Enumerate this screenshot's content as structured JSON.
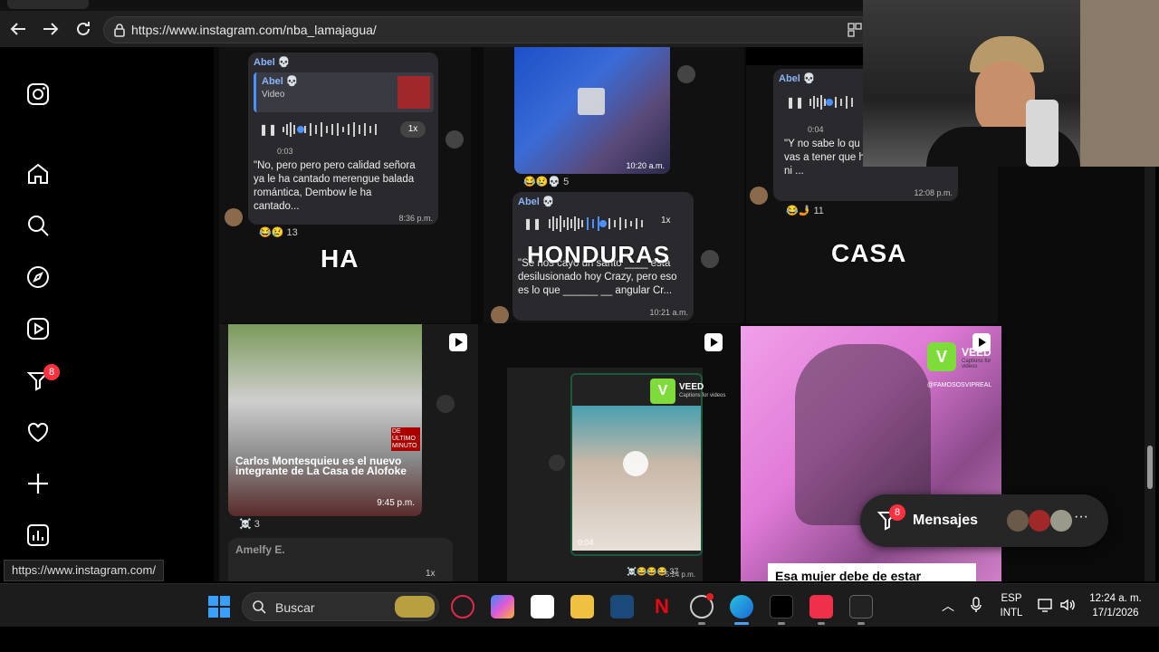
{
  "browser": {
    "url": "https://www.instagram.com/nba_lamajagua/",
    "status_url": "https://www.instagram.com/"
  },
  "instagram": {
    "nav_icons": [
      "instagram-logo-icon",
      "home-icon",
      "search-icon",
      "explore-compass-icon",
      "reels-icon",
      "notifications-icon",
      "heart-icon",
      "create-plus-icon",
      "dashboard-icon"
    ],
    "notifications_badge": "8"
  },
  "posts": {
    "tile1": {
      "sender": "Abel 💀",
      "quoted_sender": "Abel 💀",
      "quoted_type": "Video",
      "duration": "0:03",
      "speed": "1x",
      "message": "\"No, pero pero pero calidad señora ya le ha cantado merengue balada romántica, Dembow le ha cantado...",
      "time": "8:36 p.m.",
      "reactions": "😂😢 13",
      "overlay": "HA"
    },
    "tile2": {
      "image_time": "10:20 a.m.",
      "image_reactions": "😂😢💀 5",
      "sender": "Abel 💀",
      "speed": "1x",
      "message": "\"Se nos cayó un santo ____ está desilusionado hoy Crazy, pero eso es lo que ______ __ angular Cr...",
      "time": "10:21 a.m.",
      "overlay": "HONDURAS"
    },
    "tile3": {
      "sender": "Abel 💀",
      "duration": "0:04",
      "message": "\"Y no sabe lo qu metió ese loco, vas a tener que hacer esa casa, ya ni ...",
      "time": "12:08 p.m.",
      "reactions": "😂🤳 11",
      "overlay": "CASA"
    },
    "tile4": {
      "badge": "DE ÚLTIMO MINUTO",
      "headline": "Carlos Montesquieu es el nuevo integrante de La Casa de Alofoke",
      "time": "9:45 p.m.",
      "reactions": "☠️ 3",
      "next_sender": "Amelfy E.",
      "next_speed": "1x"
    },
    "tile5": {
      "veed_brand": "VEED",
      "veed_tagline": "Captions for videos",
      "video_time": "0:04",
      "video_stamp": "5:24 p.m.",
      "reactions": "☠️😂😂😂 37"
    },
    "tile6": {
      "veed_brand": "VEED",
      "veed_tagline": "Captions for videos",
      "watermark": "@FAMOSOSVIPREAL",
      "caption": "Esa mujer debe de estar"
    }
  },
  "messages_pill": {
    "label": "Mensajes",
    "badge": "8",
    "more": "···"
  },
  "taskbar": {
    "search_label": "Buscar",
    "language_top": "ESP",
    "language_bottom": "INTL",
    "time": "12:24 a. m.",
    "date": "17/1/2026"
  },
  "colors": {
    "instagram_badge": "#ff3040",
    "waveform_accent": "#4a90ff",
    "veed_green": "#7ddc3a",
    "pink_scene": "#e07ad8"
  }
}
